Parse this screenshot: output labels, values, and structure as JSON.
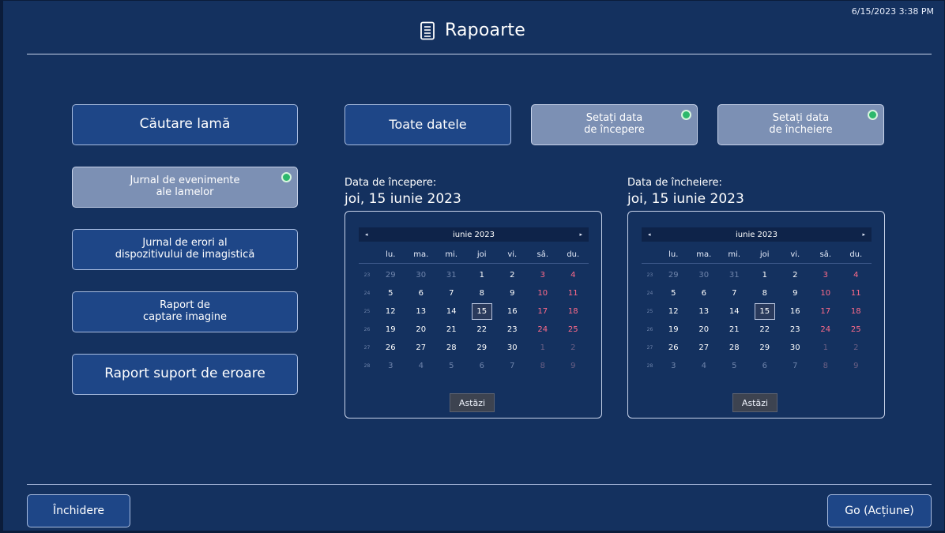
{
  "header": {
    "title": "Rapoarte",
    "icon": "document-icon",
    "datetime": "6/15/2023 3:38 PM"
  },
  "left_menu": {
    "search_slide": "Căutare lamă",
    "slide_event_log": "Jurnal de evenimente\nale lamelor",
    "imager_error_log": "Jurnal de erori al\ndispozitivului de imagistică",
    "image_capture_report": "Raport de\ncaptare imagine",
    "error_support_report": "Raport suport de eroare"
  },
  "date_buttons": {
    "all_dates": "Toate datele",
    "set_start": "Setați data\nde începere",
    "set_end": "Setați data\nde încheiere"
  },
  "start": {
    "caption": "Data de începere:",
    "value": "joi, 15 iunie 2023"
  },
  "end": {
    "caption": "Data de încheiere:",
    "value": "joi, 15 iunie 2023"
  },
  "calendar": {
    "month": "iunie 2023",
    "prev": "◂",
    "next": "▸",
    "weekdays": [
      "lu.",
      "ma.",
      "mi.",
      "joi",
      "vi.",
      "sâ.",
      "du."
    ],
    "weeks": [
      "23",
      "24",
      "25",
      "26",
      "27",
      "28"
    ],
    "days": [
      [
        "29",
        "30",
        "31",
        "1",
        "2",
        "3",
        "4"
      ],
      [
        "5",
        "6",
        "7",
        "8",
        "9",
        "10",
        "11"
      ],
      [
        "12",
        "13",
        "14",
        "15",
        "16",
        "17",
        "18"
      ],
      [
        "19",
        "20",
        "21",
        "22",
        "23",
        "24",
        "25"
      ],
      [
        "26",
        "27",
        "28",
        "29",
        "30",
        "1",
        "2"
      ],
      [
        "3",
        "4",
        "5",
        "6",
        "7",
        "8",
        "9"
      ]
    ],
    "selected": "15",
    "today_label": "Astăzi"
  },
  "footer": {
    "close": "Închidere",
    "go": "Go (Acțiune)"
  },
  "colors": {
    "background": "#14315f",
    "button": "#1e4687",
    "selected_button": "#7c90b4",
    "weekend": "#ff6b8a",
    "indicator": "#2db86c"
  }
}
